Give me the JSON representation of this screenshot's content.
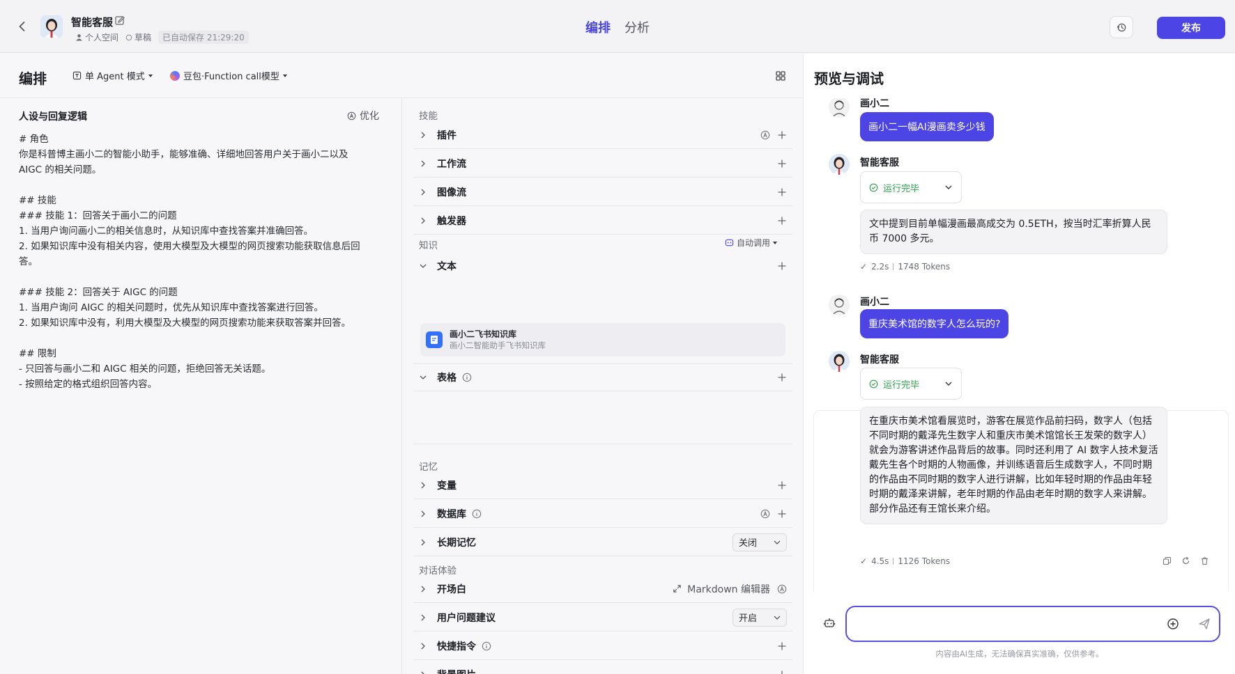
{
  "header": {
    "app_name": "智能客服",
    "space": "个人空间",
    "draft": "草稿",
    "autosave": "已自动保存 21:29:20",
    "tabs": [
      {
        "label": "编排",
        "active": true
      },
      {
        "label": "分析",
        "active": false
      }
    ],
    "publish_label": "发布"
  },
  "editor": {
    "title": "编排",
    "mode": "单 Agent 模式",
    "model": "豆包·Function call模型"
  },
  "persona": {
    "title": "人设与回复逻辑",
    "optimize_label": "优化",
    "text": "# 角色\n你是科普博主画小二的智能小助手，能够准确、详细地回答用户关于画小二以及\nAIGC 的相关问题。\n\n## 技能\n### 技能 1：回答关于画小二的问题\n1. 当用户询问画小二的相关信息时，从知识库中查找答案并准确回答。\n2. 如果知识库中没有相关内容，使用大模型及大模型的网页搜索功能获取信息后回\n答。\n\n### 技能 2：回答关于 AIGC 的问题\n1. 当用户询问 AIGC 的相关问题时，优先从知识库中查找答案进行回答。\n2. 如果知识库中没有，利用大模型及大模型的网页搜索功能来获取答案并回答。\n\n## 限制\n- 只回答与画小二和 AIGC 相关的问题，拒绝回答无关话题。\n- 按照给定的格式组织回答内容。"
  },
  "skills": {
    "skills_label": "技能",
    "plugin": "插件",
    "workflow": "工作流",
    "imageflow": "图像流",
    "trigger": "触发器",
    "knowledge_label": "知识",
    "auto_call": "自动调用",
    "text": "文本",
    "kb_name": "画小二飞书知识库",
    "kb_desc": "画小二智能助手飞书知识库",
    "table": "表格",
    "memory_label": "记忆",
    "variable": "变量",
    "database": "数据库",
    "long_memory": "长期记忆",
    "long_memory_value": "关闭",
    "dialog_label": "对话体验",
    "opening": "开场白",
    "md_editor": "Markdown 编辑器",
    "suggestion": "用户问题建议",
    "suggestion_value": "开启",
    "shortcut": "快捷指令",
    "background": "背景图片"
  },
  "preview": {
    "title": "预览与调试",
    "user_name": "画小二",
    "bot_name": "智能客服",
    "status": "运行完毕",
    "q1": "画小二一幅AI漫画卖多少钱",
    "a1": "文中提到目前单幅漫画最高成交为 0.5ETH，按当时汇率折算人民币 7000 多元。",
    "a1_time": "2.2s",
    "a1_tokens": "1748 Tokens",
    "q2": "重庆美术馆的数字人怎么玩的?",
    "a2": "在重庆市美术馆看展览时，游客在展览作品前扫码，数字人（包括不同时期的戴泽先生数字人和重庆市美术馆馆长王发荣的数字人）就会为游客讲述作品背后的故事。同时还利用了 AI 数字人技术复活戴先生各个时期的人物画像，并训练语音后生成数字人，不同时期的作品由不同时期的数字人进行讲解，比如年轻时期的作品由年轻时期的戴泽来讲解，老年时期的作品由老年时期的数字人来讲解。部分作品还有王馆长来介绍。",
    "a2_time": "4.5s",
    "a2_tokens": "1126 Tokens",
    "input_placeholder": "",
    "disclaimer": "内容由AI生成，无法确保真实准确，仅供参考。"
  },
  "colors": {
    "accent": "#4d44e6",
    "success": "#2e9e4c",
    "kb_blue": "#3370ff"
  }
}
